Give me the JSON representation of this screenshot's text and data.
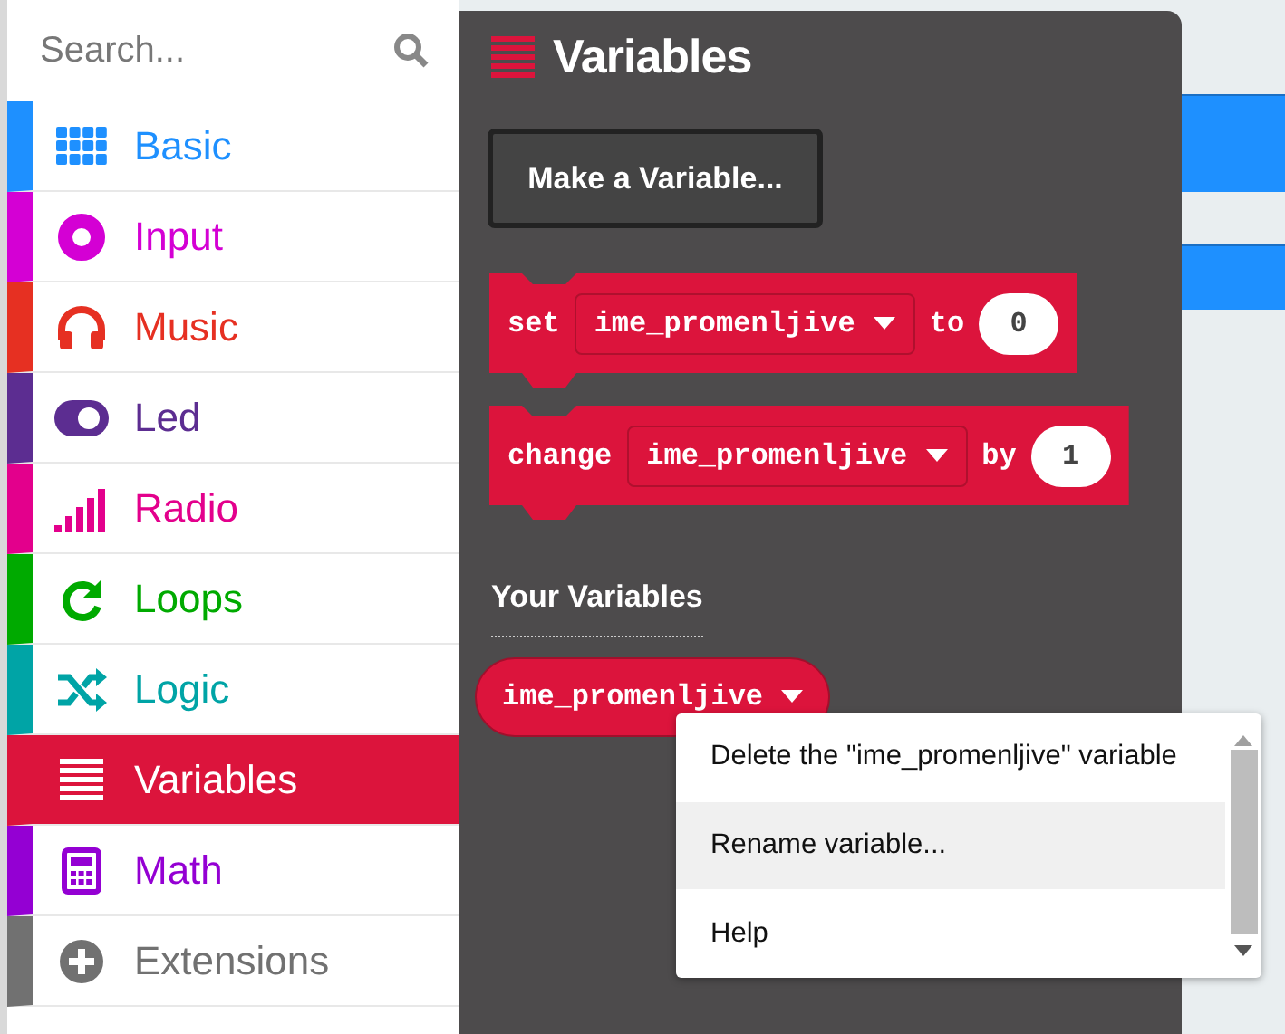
{
  "search": {
    "placeholder": "Search..."
  },
  "categories": [
    {
      "label": "Basic",
      "color": "#1e90ff",
      "selected": false
    },
    {
      "label": "Input",
      "color": "#d400d4",
      "selected": false
    },
    {
      "label": "Music",
      "color": "#e63022",
      "selected": false
    },
    {
      "label": "Led",
      "color": "#5c2d91",
      "selected": false
    },
    {
      "label": "Radio",
      "color": "#e3008c",
      "selected": false
    },
    {
      "label": "Loops",
      "color": "#00aa00",
      "selected": false
    },
    {
      "label": "Logic",
      "color": "#00a4a6",
      "selected": false
    },
    {
      "label": "Variables",
      "color": "#dc143c",
      "selected": true
    },
    {
      "label": "Math",
      "color": "#9400d3",
      "selected": false
    },
    {
      "label": "Extensions",
      "color": "#717171",
      "selected": false
    }
  ],
  "flyout": {
    "title": "Variables",
    "button": "Make a Variable...",
    "blocks": [
      {
        "keyword": "set",
        "variable": "ime_promenljive",
        "joiner": "to",
        "value": "0"
      },
      {
        "keyword": "change",
        "variable": "ime_promenljive",
        "joiner": "by",
        "value": "1"
      }
    ],
    "section_label": "Your Variables",
    "variable": "ime_promenljive"
  },
  "context_menu": {
    "items": [
      {
        "label": "Delete the \"ime_promenljive\" variable",
        "hovered": false
      },
      {
        "label": "Rename variable...",
        "hovered": true
      },
      {
        "label": "Help",
        "hovered": false
      }
    ]
  }
}
